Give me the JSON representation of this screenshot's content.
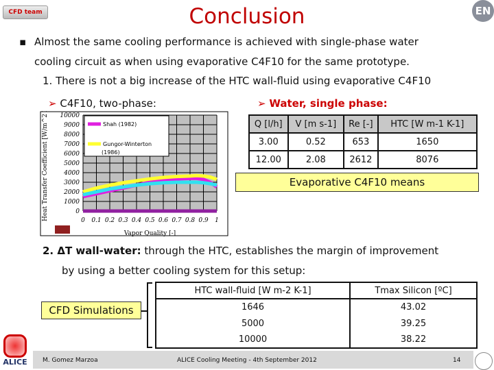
{
  "header": {
    "title": "Conclusion",
    "logo_left": "CFD team",
    "logo_right": "EN"
  },
  "bullet1": {
    "line1": "Almost the same cooling performance is achieved with single-phase water",
    "line2": "cooling circuit as when using evaporative C4F10 for the same prototype."
  },
  "item1": "1. There is not a big increase of the HTC wall-fluid using evaporative C4F10",
  "c4f10_label": "C4F10, two-phase:",
  "water_label": "Water, single phase:",
  "chart_data": {
    "type": "line",
    "ylabel": "Heat Transfer Coefficient [W/m^2 K]",
    "xlabel": "Vapor Quality [-]",
    "xlim": [
      0,
      1
    ],
    "ylim": [
      0,
      10000
    ],
    "yticks": [
      "0",
      "1000",
      "2000",
      "3000",
      "4000",
      "5000",
      "6000",
      "7000",
      "8000",
      "9000",
      "10000"
    ],
    "xticks": [
      "0",
      "0.1",
      "0.2",
      "0.3",
      "0.4",
      "0.5",
      "0.6",
      "0.7",
      "0.8",
      "0.9",
      "1"
    ],
    "grid": true,
    "legend_placement": "top-left",
    "x": [
      0,
      0.1,
      0.2,
      0.3,
      0.4,
      0.5,
      0.6,
      0.7,
      0.8,
      0.85,
      0.9,
      0.95,
      1
    ],
    "series": [
      {
        "name": "Shah (1982)",
        "color": "#e020e0",
        "values": [
          1500,
          1800,
          2100,
          2400,
          2700,
          3000,
          3200,
          3350,
          3400,
          3400,
          3300,
          3000,
          2500
        ]
      },
      {
        "name": "Gungor-Winterton (1986)",
        "color": "#ffff30",
        "values": [
          2000,
          2400,
          2700,
          2950,
          3150,
          3350,
          3500,
          3600,
          3650,
          3700,
          3650,
          3550,
          3300
        ]
      },
      {
        "color": "#30e0f0",
        "values": [
          1700,
          2000,
          2300,
          2500,
          2700,
          2850,
          2950,
          3000,
          3000,
          3000,
          2950,
          2850,
          2700
        ]
      },
      {
        "color": "#9020a0",
        "values": [
          0,
          0,
          0,
          0,
          0,
          0,
          0,
          0,
          0,
          0,
          0,
          0,
          0
        ]
      }
    ]
  },
  "water_table": {
    "headers": [
      "Q [l/h]",
      "V [m s-1]",
      "Re [-]",
      "HTC [W m-1 K-1]"
    ],
    "rows": [
      [
        "3.00",
        "0.52",
        "653",
        "1650"
      ],
      [
        "12.00",
        "2.08",
        "2612",
        "8076"
      ]
    ]
  },
  "evap_box": "Evaporative C4F10 means",
  "item2": {
    "line1_bold": "2. ΔT wall-water:",
    "line1": " through the HTC, establishes the margin of improvement",
    "line2": "by using a better cooling system for this setup:"
  },
  "cfd_box": "CFD Simulations",
  "sim_table": {
    "headers": [
      "HTC wall-fluid [W m-2 K-1]",
      "Tmax Silicon [ºC]"
    ],
    "rows": [
      [
        "1646",
        "43.02"
      ],
      [
        "5000",
        "39.25"
      ],
      [
        "10000",
        "38.22"
      ]
    ]
  },
  "footer": {
    "author": "M. Gomez Marzoa",
    "meeting": "ALICE Cooling Meeting - 4th September 2012",
    "page": "14",
    "logo": "ALICE"
  }
}
